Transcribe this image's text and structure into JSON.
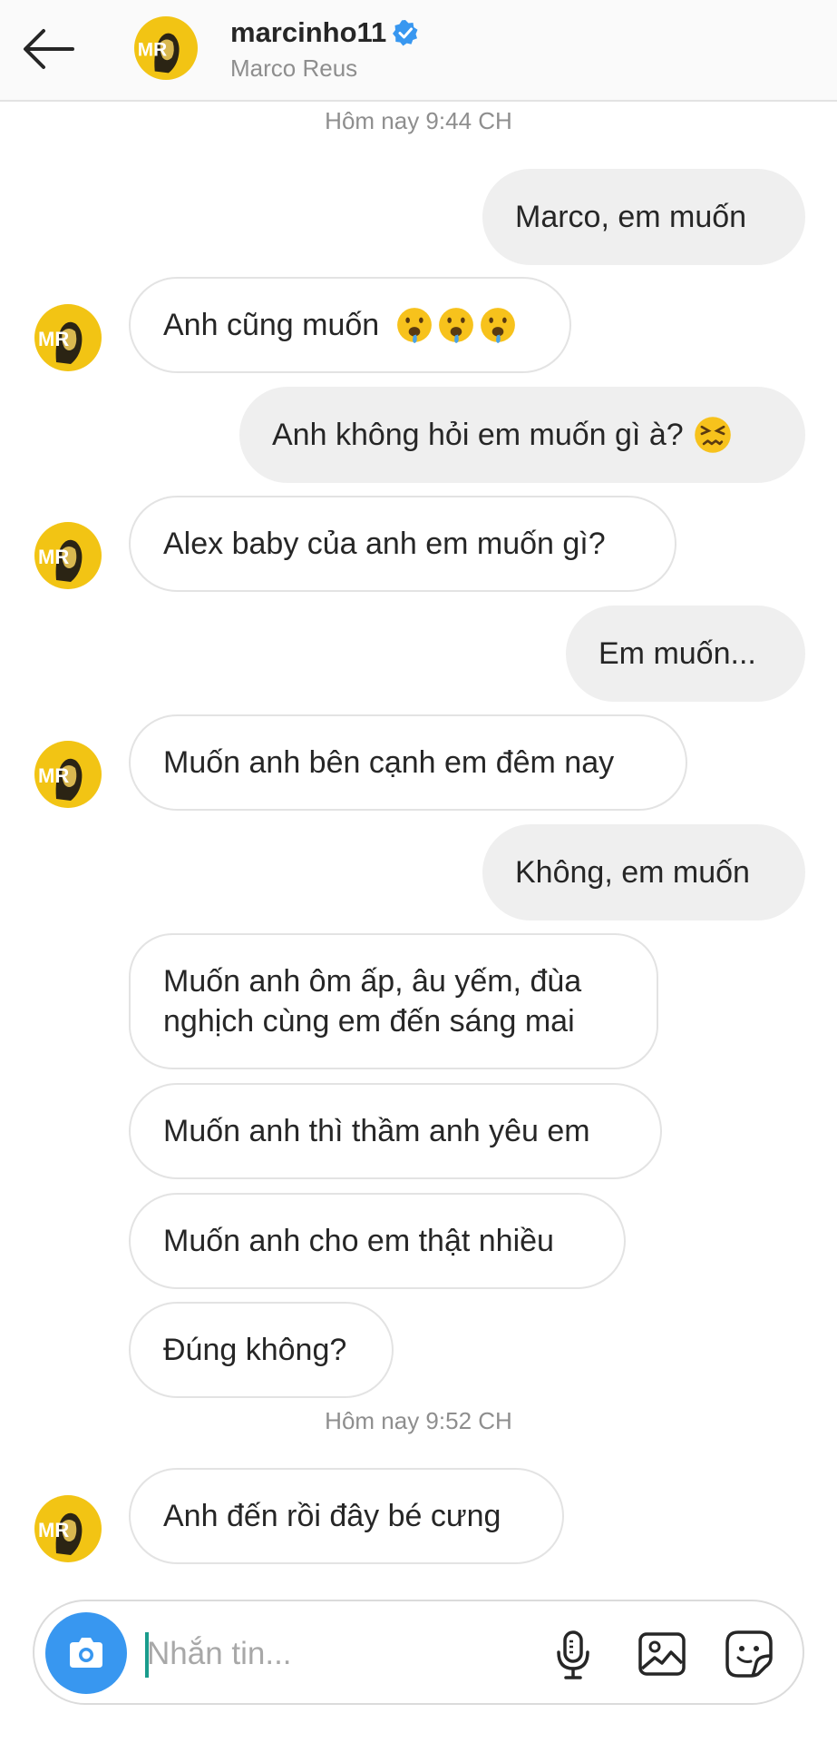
{
  "header": {
    "username": "marcinho11",
    "full_name": "Marco Reus",
    "verified": true
  },
  "messages": [
    {
      "type": "timestamp",
      "text": "Hôm nay 9:44 CH"
    },
    {
      "type": "outgoing",
      "text": "Marco, em muốn"
    },
    {
      "type": "incoming",
      "text": "Anh cũng muốn",
      "emojis": [
        "drooling-face",
        "drooling-face",
        "drooling-face"
      ],
      "avatar": true
    },
    {
      "type": "outgoing",
      "text": "Anh không hỏi em muốn gì à?",
      "emojis": [
        "confounded-face"
      ]
    },
    {
      "type": "incoming",
      "text": "Alex baby của anh em muốn gì?",
      "avatar": true
    },
    {
      "type": "outgoing",
      "text": "Em muốn..."
    },
    {
      "type": "incoming",
      "text": "Muốn anh bên cạnh em đêm nay",
      "avatar": true
    },
    {
      "type": "outgoing",
      "text": "Không, em muốn"
    },
    {
      "type": "incoming",
      "text": "Muốn anh ôm ấp, âu yếm, đùa\nnghịch cùng em đến sáng mai",
      "avatar": false
    },
    {
      "type": "incoming",
      "text": "Muốn anh thì thầm anh yêu em",
      "avatar": false
    },
    {
      "type": "incoming",
      "text": "Muốn anh cho em thật nhiều",
      "avatar": false
    },
    {
      "type": "incoming",
      "text": "Đúng không?",
      "avatar": false
    },
    {
      "type": "timestamp",
      "text": "Hôm nay 9:52 CH"
    },
    {
      "type": "incoming",
      "text": "Anh đến rồi đây bé cưng",
      "avatar": true
    }
  ],
  "composer": {
    "placeholder": "Nhắn tin...",
    "icons": [
      "camera-icon",
      "microphone-icon",
      "gallery-icon",
      "sticker-icon"
    ]
  },
  "colors": {
    "accent_blue": "#3897f0",
    "outgoing_bubble": "#efefef",
    "incoming_border": "#e3e3e3",
    "avatar_yellow": "#f2c414"
  }
}
